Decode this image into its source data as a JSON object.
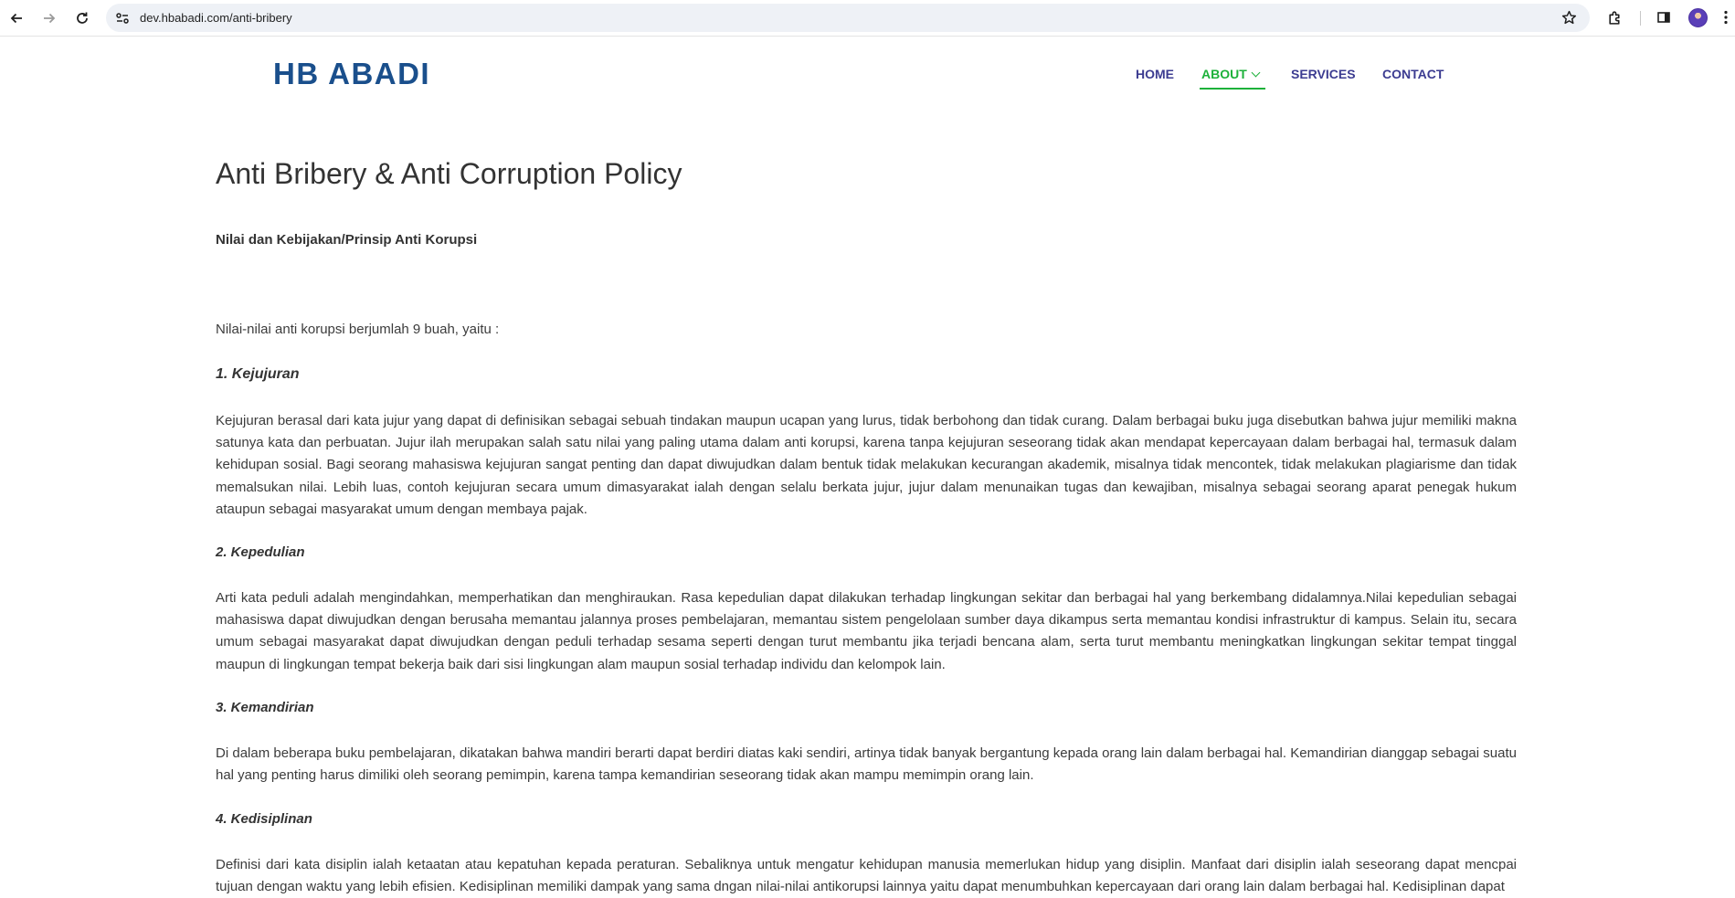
{
  "browser": {
    "url": "dev.hbabadi.com/anti-bribery"
  },
  "site": {
    "logo": "HB ABADI",
    "menu": {
      "home": "HOME",
      "about": "ABOUT",
      "services": "SERVICES",
      "contact": "CONTACT"
    }
  },
  "page": {
    "title": "Anti Bribery & Anti Corruption Policy",
    "subtitle": "Nilai dan Kebijakan/Prinsip Anti Korupsi",
    "intro": "Nilai-nilai anti korupsi berjumlah 9 buah, yaitu :",
    "sections": [
      {
        "heading": "1. Kejujuran",
        "text": "Kejujuran berasal dari kata jujur yang dapat di definisikan sebagai sebuah tindakan maupun ucapan yang lurus, tidak berbohong dan tidak curang. Dalam berbagai buku juga disebutkan bahwa jujur memiliki makna satunya kata dan perbuatan. Jujur ilah merupakan salah satu nilai yang paling utama dalam anti korupsi, karena tanpa kejujuran seseorang tidak akan mendapat kepercayaan dalam berbagai hal, termasuk dalam kehidupan sosial. Bagi seorang mahasiswa kejujuran sangat penting dan dapat diwujudkan dalam bentuk tidak melakukan kecurangan akademik, misalnya tidak mencontek, tidak melakukan plagiarisme dan tidak memalsukan nilai. Lebih luas, contoh kejujuran secara umum dimasyarakat ialah dengan selalu berkata jujur, jujur dalam menunaikan tugas dan kewajiban, misalnya sebagai seorang aparat penegak hukum ataupun sebagai masyarakat umum dengan membaya pajak."
      },
      {
        "heading": "2. Kepedulian",
        "text": "Arti kata peduli adalah mengindahkan, memperhatikan dan menghiraukan. Rasa kepedulian dapat dilakukan terhadap lingkungan sekitar dan berbagai hal yang berkembang didalamnya.Nilai kepedulian sebagai mahasiswa dapat diwujudkan dengan berusaha memantau jalannya proses pembelajaran, memantau sistem pengelolaan sumber daya dikampus serta memantau kondisi infrastruktur di kampus. Selain itu, secara umum sebagai masyarakat dapat diwujudkan dengan peduli terhadap sesama seperti dengan turut membantu jika terjadi bencana alam, serta turut membantu meningkatkan lingkungan sekitar tempat tinggal maupun di lingkungan tempat bekerja baik dari sisi lingkungan alam maupun sosial terhadap individu dan kelompok lain."
      },
      {
        "heading": "3. Kemandirian",
        "text": "Di dalam beberapa buku pembelajaran, dikatakan bahwa mandiri berarti dapat berdiri diatas kaki sendiri, artinya tidak banyak bergantung kepada orang lain dalam berbagai hal. Kemandirian dianggap sebagai suatu hal yang penting harus dimiliki oleh seorang pemimpin, karena tampa kemandirian seseorang tidak akan mampu memimpin orang lain."
      },
      {
        "heading": "4. Kedisiplinan",
        "text": "Definisi dari kata disiplin ialah ketaatan atau kepatuhan kepada peraturan. Sebaliknya untuk mengatur kehidupan manusia memerlukan hidup yang disiplin. Manfaat dari disiplin ialah seseorang dapat mencpai tujuan dengan waktu yang lebih efisien. Kedisiplinan memiliki dampak yang sama dngan nilai-nilai antikorupsi lainnya yaitu dapat menumbuhkan kepercayaan dari orang lain dalam berbagai hal. Kedisiplinan dapat"
      }
    ]
  },
  "colors": {
    "logo": "#1a4f8c",
    "menu": "#3c3c91",
    "menu_active": "#1db13a",
    "text": "#333333"
  },
  "icons": [
    "back-icon",
    "forward-icon",
    "reload-icon",
    "site-info-icon",
    "bookmark-star-icon",
    "extensions-icon",
    "side-panel-icon",
    "menu-dots-icon"
  ]
}
